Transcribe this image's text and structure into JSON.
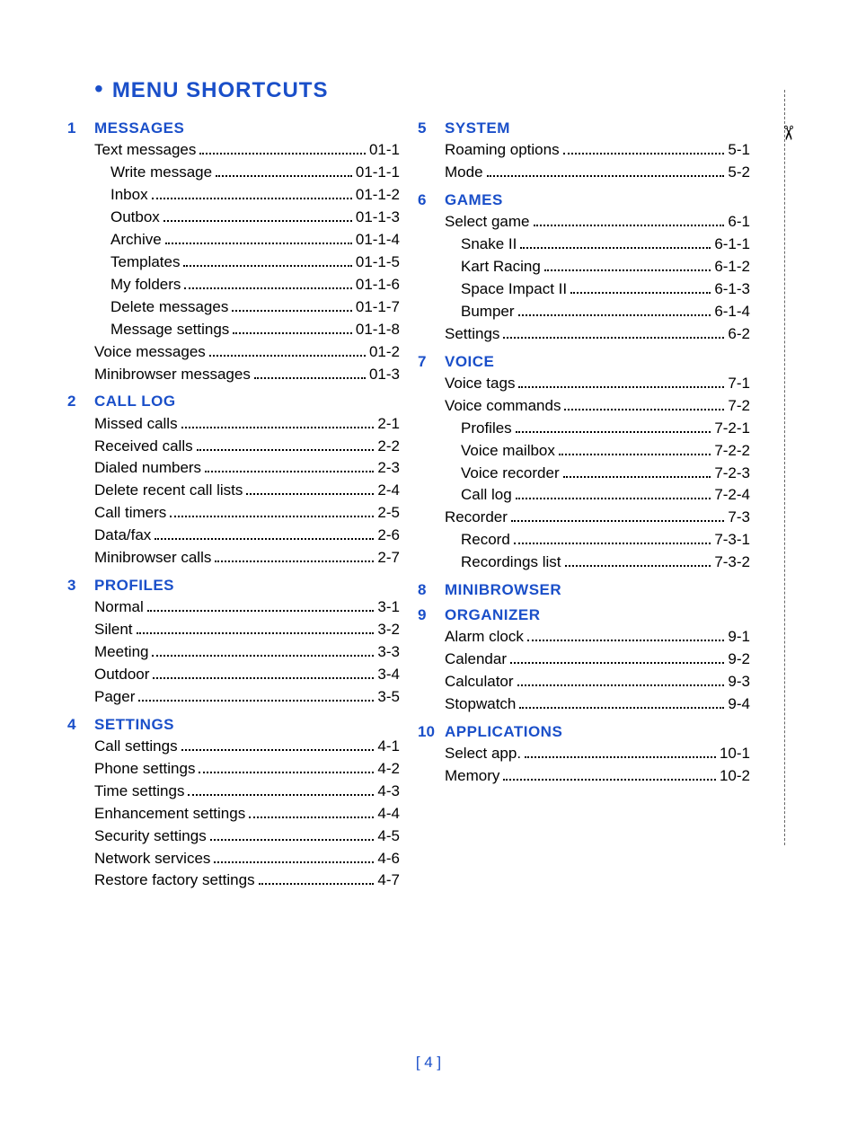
{
  "title": "MENU SHORTCUTS",
  "page_label": "[ 4 ]",
  "left": [
    {
      "num": "1",
      "title": "MESSAGES",
      "rows": [
        {
          "i": 1,
          "label": "Text messages",
          "code": "01-1"
        },
        {
          "i": 2,
          "label": "Write message",
          "code": "01-1-1"
        },
        {
          "i": 2,
          "label": "Inbox",
          "code": "01-1-2"
        },
        {
          "i": 2,
          "label": "Outbox",
          "code": "01-1-3"
        },
        {
          "i": 2,
          "label": "Archive",
          "code": "01-1-4"
        },
        {
          "i": 2,
          "label": "Templates",
          "code": "01-1-5"
        },
        {
          "i": 2,
          "label": "My folders",
          "code": "01-1-6"
        },
        {
          "i": 2,
          "label": "Delete messages",
          "code": "01-1-7"
        },
        {
          "i": 2,
          "label": "Message settings",
          "code": "01-1-8"
        },
        {
          "i": 1,
          "label": "Voice messages",
          "code": "01-2"
        },
        {
          "i": 1,
          "label": "Minibrowser messages",
          "code": "01-3"
        }
      ]
    },
    {
      "num": "2",
      "title": "CALL LOG",
      "rows": [
        {
          "i": 1,
          "label": "Missed calls",
          "code": "2-1"
        },
        {
          "i": 1,
          "label": "Received calls",
          "code": "2-2"
        },
        {
          "i": 1,
          "label": "Dialed numbers",
          "code": "2-3"
        },
        {
          "i": 1,
          "label": "Delete recent call lists",
          "code": "2-4"
        },
        {
          "i": 1,
          "label": "Call timers",
          "code": "2-5"
        },
        {
          "i": 1,
          "label": "Data/fax",
          "code": "2-6"
        },
        {
          "i": 1,
          "label": "Minibrowser calls",
          "code": "2-7"
        }
      ]
    },
    {
      "num": "3",
      "title": "PROFILES",
      "rows": [
        {
          "i": 1,
          "label": "Normal",
          "code": "3-1"
        },
        {
          "i": 1,
          "label": "Silent",
          "code": "3-2"
        },
        {
          "i": 1,
          "label": "Meeting",
          "code": "3-3"
        },
        {
          "i": 1,
          "label": "Outdoor",
          "code": "3-4"
        },
        {
          "i": 1,
          "label": "Pager",
          "code": "3-5"
        }
      ]
    },
    {
      "num": "4",
      "title": "SETTINGS",
      "rows": [
        {
          "i": 1,
          "label": "Call settings",
          "code": "4-1"
        },
        {
          "i": 1,
          "label": "Phone settings",
          "code": "4-2"
        },
        {
          "i": 1,
          "label": "Time settings",
          "code": "4-3"
        },
        {
          "i": 1,
          "label": "Enhancement settings",
          "code": "4-4"
        },
        {
          "i": 1,
          "label": "Security settings",
          "code": "4-5"
        },
        {
          "i": 1,
          "label": "Network services",
          "code": "4-6"
        },
        {
          "i": 1,
          "label": "Restore factory settings",
          "code": "4-7"
        }
      ]
    }
  ],
  "right": [
    {
      "num": "5",
      "title": "SYSTEM",
      "rows": [
        {
          "i": 1,
          "label": "Roaming options",
          "code": "5-1"
        },
        {
          "i": 1,
          "label": "Mode",
          "code": "5-2"
        }
      ]
    },
    {
      "num": "6",
      "title": "GAMES",
      "rows": [
        {
          "i": 1,
          "label": "Select game",
          "code": "6-1"
        },
        {
          "i": 2,
          "label": "Snake II",
          "code": "6-1-1"
        },
        {
          "i": 2,
          "label": "Kart Racing",
          "code": "6-1-2"
        },
        {
          "i": 2,
          "label": "Space Impact II",
          "code": "6-1-3"
        },
        {
          "i": 2,
          "label": "Bumper",
          "code": "6-1-4"
        },
        {
          "i": 1,
          "label": "Settings",
          "code": "6-2"
        }
      ]
    },
    {
      "num": "7",
      "title": "VOICE",
      "rows": [
        {
          "i": 1,
          "label": "Voice tags",
          "code": "7-1"
        },
        {
          "i": 1,
          "label": "Voice commands",
          "code": "7-2"
        },
        {
          "i": 2,
          "label": "Profiles",
          "code": "7-2-1"
        },
        {
          "i": 2,
          "label": "Voice mailbox",
          "code": "7-2-2"
        },
        {
          "i": 2,
          "label": "Voice recorder",
          "code": "7-2-3"
        },
        {
          "i": 2,
          "label": "Call log",
          "code": "7-2-4"
        },
        {
          "i": 1,
          "label": "Recorder",
          "code": "7-3"
        },
        {
          "i": 2,
          "label": "Record",
          "code": "7-3-1"
        },
        {
          "i": 2,
          "label": "Recordings list",
          "code": "7-3-2"
        }
      ]
    },
    {
      "num": "8",
      "title": "MINIBROWSER",
      "rows": []
    },
    {
      "num": "9",
      "title": "ORGANIZER",
      "rows": [
        {
          "i": 1,
          "label": "Alarm clock",
          "code": "9-1"
        },
        {
          "i": 1,
          "label": "Calendar",
          "code": "9-2"
        },
        {
          "i": 1,
          "label": "Calculator",
          "code": "9-3"
        },
        {
          "i": 1,
          "label": "Stopwatch",
          "code": "9-4"
        }
      ]
    },
    {
      "num": "10",
      "title": "APPLICATIONS",
      "rows": [
        {
          "i": 1,
          "label": "Select app.",
          "code": "10-1"
        },
        {
          "i": 1,
          "label": "Memory",
          "code": "10-2"
        }
      ]
    }
  ]
}
